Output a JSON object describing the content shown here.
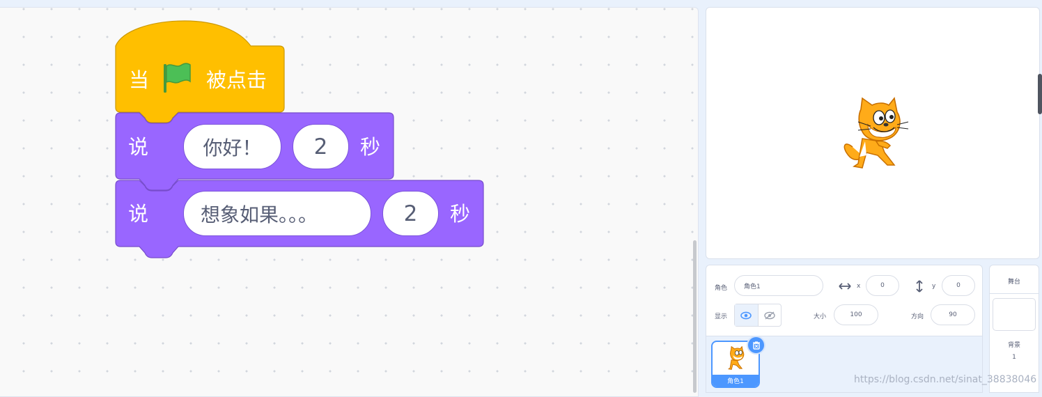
{
  "script": {
    "hat": {
      "word_when": "当",
      "word_clicked": "被点击",
      "icon": "green-flag-icon"
    },
    "say_blocks": [
      {
        "verb": "说",
        "message": "你好！",
        "secs": "2",
        "unit": "秒"
      },
      {
        "verb": "说",
        "message": "想象如果。。。",
        "secs": "2",
        "unit": "秒"
      }
    ]
  },
  "sprite_info": {
    "sprite_label": "角色",
    "sprite_name": "角色1",
    "x_label": "x",
    "x_value": "0",
    "y_label": "y",
    "y_value": "0",
    "show_label": "显示",
    "size_label": "大小",
    "size_value": "100",
    "direction_label": "方向",
    "direction_value": "90"
  },
  "sprite_list": [
    {
      "name": "角色1",
      "icon": "cat-sprite-icon"
    }
  ],
  "stage_pane": {
    "title": "舞台",
    "backdrops_label": "背景",
    "backdrops_count": "1"
  },
  "watermark": "https://blog.csdn.net/sinat_38838046",
  "colors": {
    "events_yellow": "#ffbf00",
    "looks_purple": "#9966ff",
    "accent_blue": "#4c97ff"
  }
}
